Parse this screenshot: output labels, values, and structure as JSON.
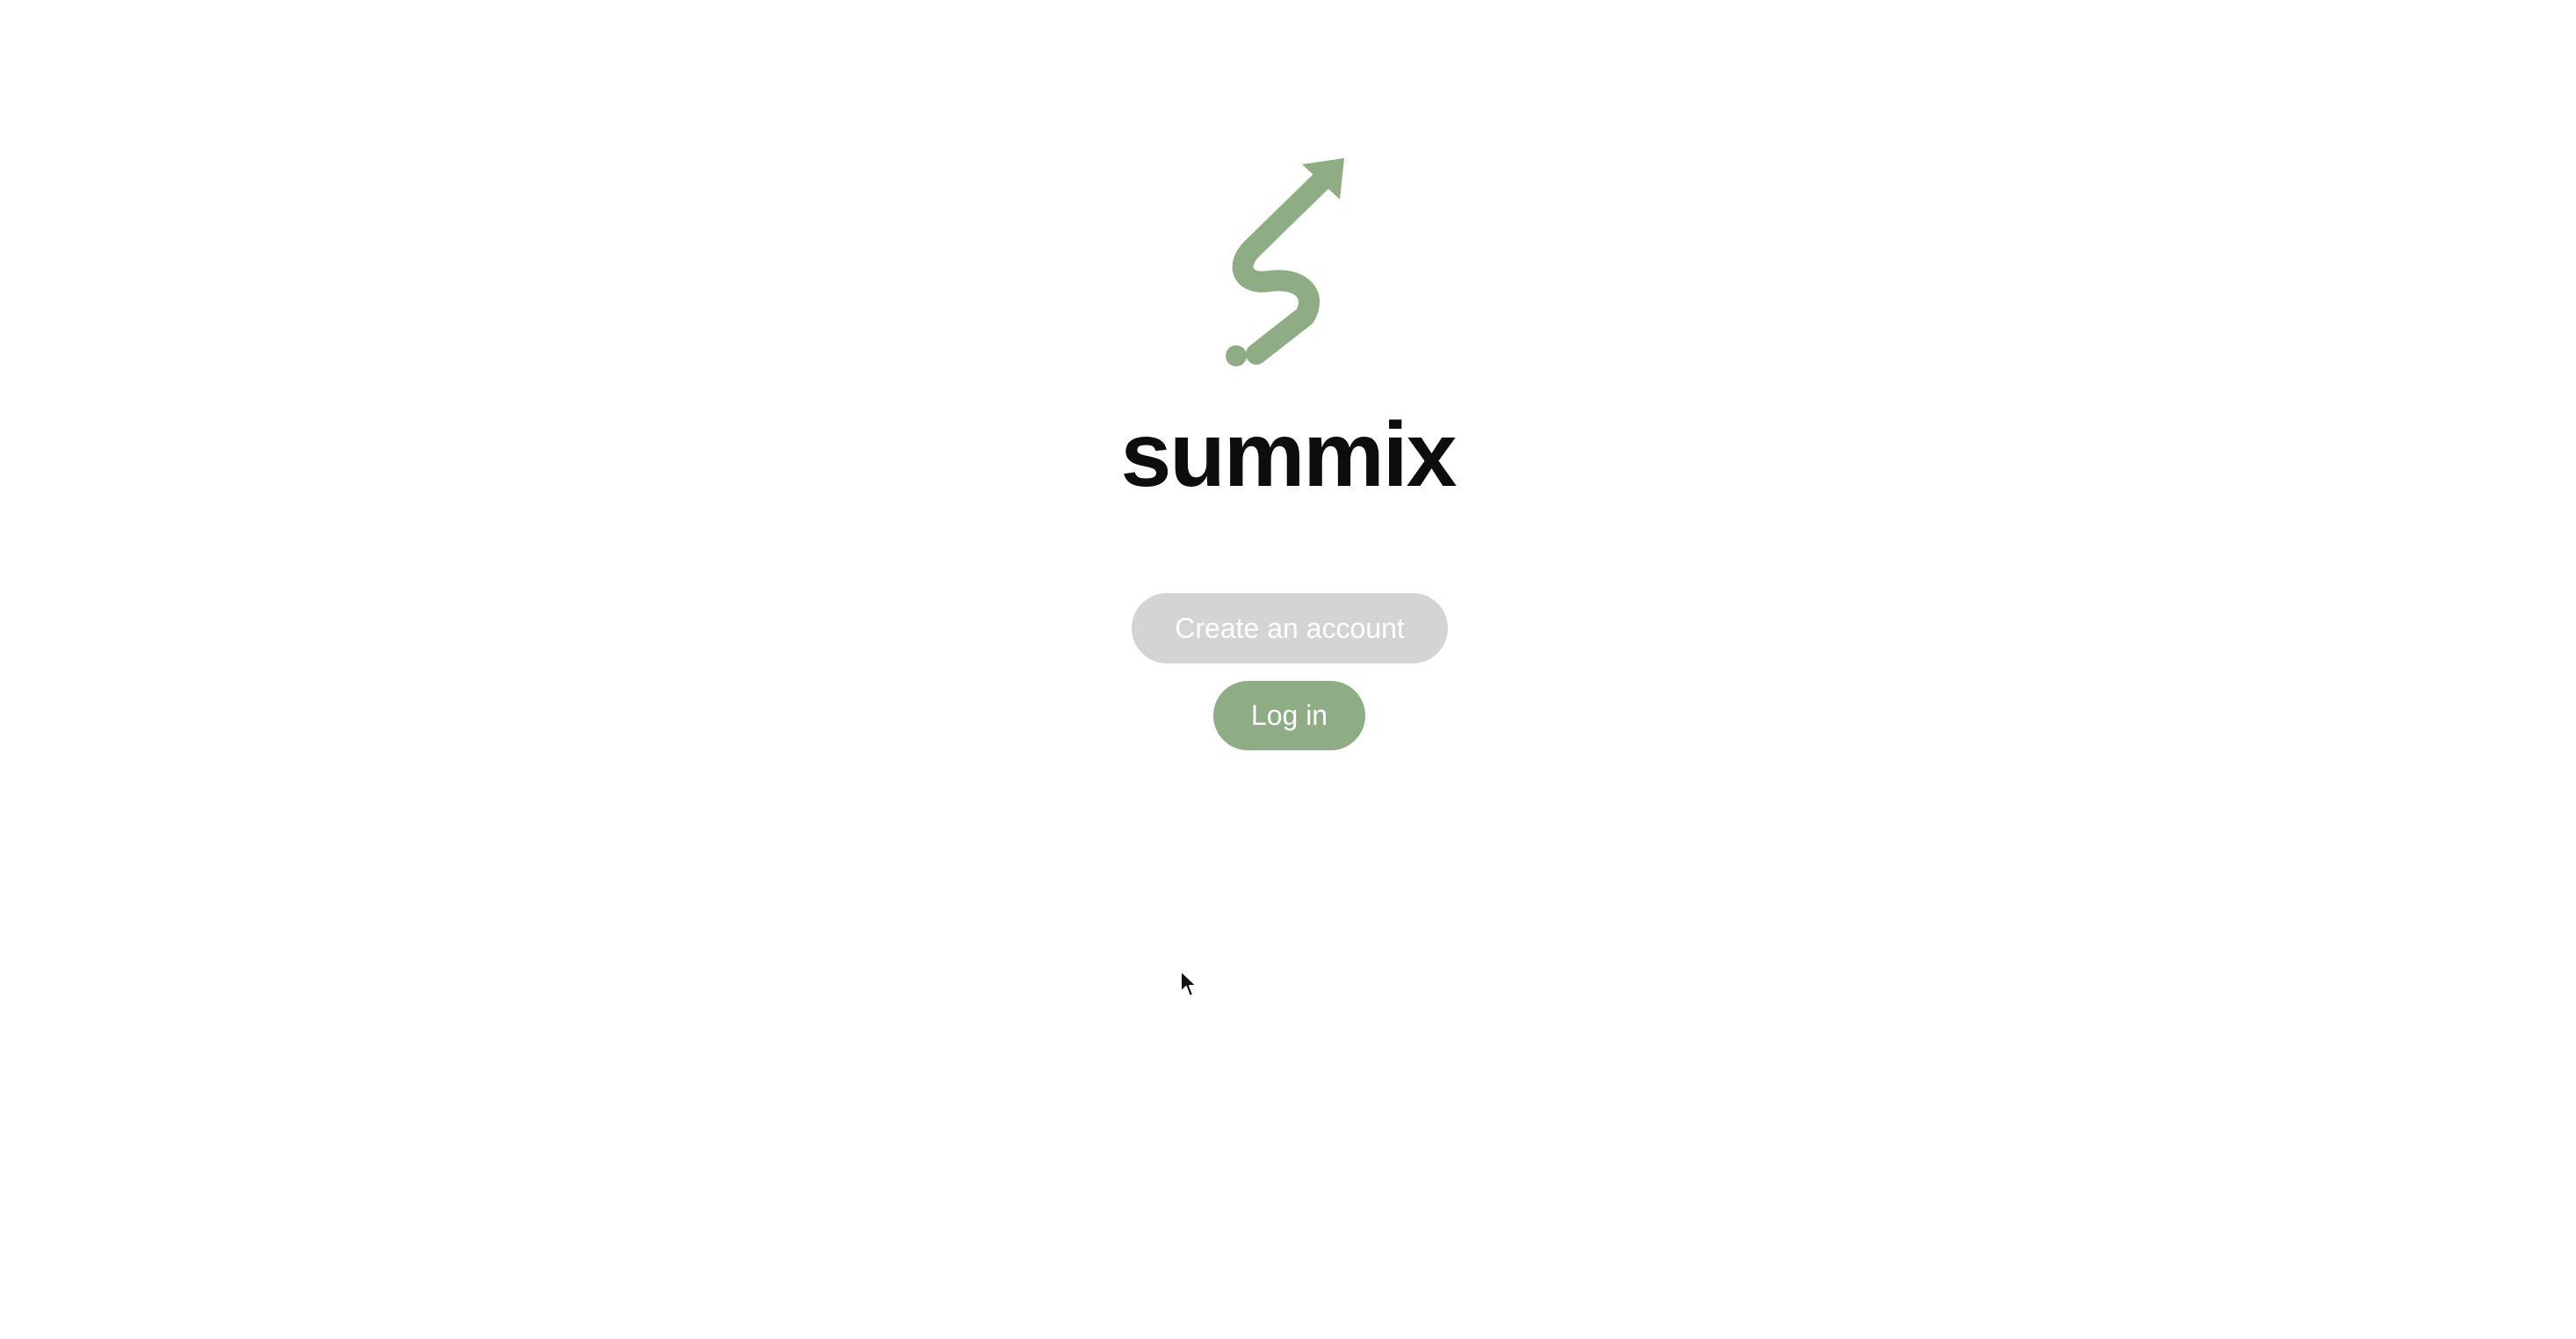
{
  "brand": {
    "name": "summix"
  },
  "actions": {
    "create_account_label": "Create an account",
    "login_label": "Log in"
  },
  "colors": {
    "background": "#ffffff",
    "brand_green": "#8ead84",
    "disabled_gray": "#d4d4d4",
    "text_dark": "#0d0d0d"
  },
  "icons": {
    "logo": "summix-squiggle-arrow-logo",
    "cursor": "mouse-pointer-icon"
  }
}
